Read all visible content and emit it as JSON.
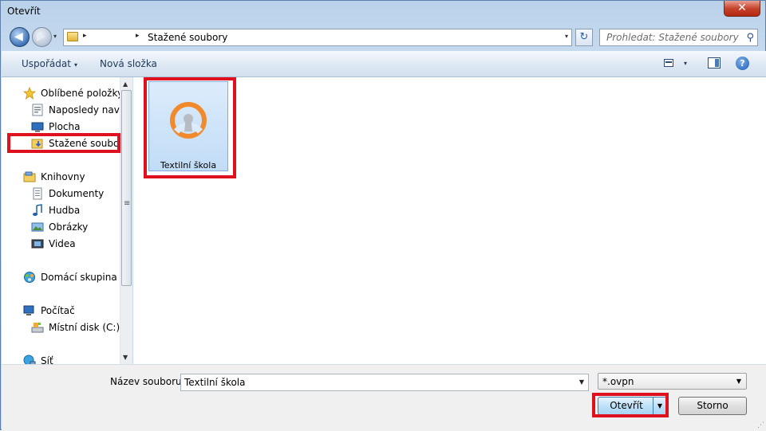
{
  "window": {
    "title": "Otevřít",
    "close_glyph": "✕"
  },
  "nav": {
    "back_glyph": "◀",
    "forward_glyph": "▶",
    "recent_glyph": "▾",
    "address_chevron": "▸",
    "address_path": "Stažené soubory",
    "address_drop": "▾",
    "refresh_glyph": "↻",
    "search_placeholder": "Prohledat: Stažené soubory",
    "search_glyph": "⚲"
  },
  "toolbar": {
    "organize_label": "Uspořádat",
    "new_folder_label": "Nová složka",
    "caret": "▾",
    "help_glyph": "?"
  },
  "sidebar": {
    "favorites": {
      "label": "Oblíbené položky",
      "icon": "star-icon"
    },
    "items_favorites": [
      {
        "label": "Naposledy navštívené",
        "icon": "recent-places-icon"
      },
      {
        "label": "Plocha",
        "icon": "desktop-icon"
      },
      {
        "label": "Stažené soubory",
        "icon": "downloads-folder-icon"
      }
    ],
    "libraries": {
      "label": "Knihovny",
      "icon": "libraries-icon"
    },
    "items_libraries": [
      {
        "label": "Dokumenty",
        "icon": "documents-icon"
      },
      {
        "label": "Hudba",
        "icon": "music-icon"
      },
      {
        "label": "Obrázky",
        "icon": "pictures-icon"
      },
      {
        "label": "Videa",
        "icon": "videos-icon"
      }
    ],
    "homegroup": {
      "label": "Domácí skupina",
      "icon": "homegroup-icon"
    },
    "computer": {
      "label": "Počítač",
      "icon": "computer-icon"
    },
    "items_computer": [
      {
        "label": "Místní disk (C:)",
        "icon": "local-disk-icon"
      }
    ],
    "network": {
      "label": "Síť",
      "icon": "network-icon"
    }
  },
  "scrollbar": {
    "up": "▲",
    "down": "▼",
    "grip": "≡"
  },
  "files": [
    {
      "name": "Textilní škola",
      "icon": "openvpn-config-icon"
    }
  ],
  "bottom": {
    "filename_label": "Název souboru:",
    "filename_value": "Textilní škola",
    "filename_drop": "▼",
    "filter_value": "*.ovpn",
    "filter_drop": "▼",
    "open_label": "Otevřít",
    "open_split": "▼",
    "cancel_label": "Storno",
    "grip": "⋰"
  },
  "colors": {
    "highlight": "#e0111f",
    "openvpn_orange": "#f08a2c",
    "accent": "#1e395b"
  }
}
